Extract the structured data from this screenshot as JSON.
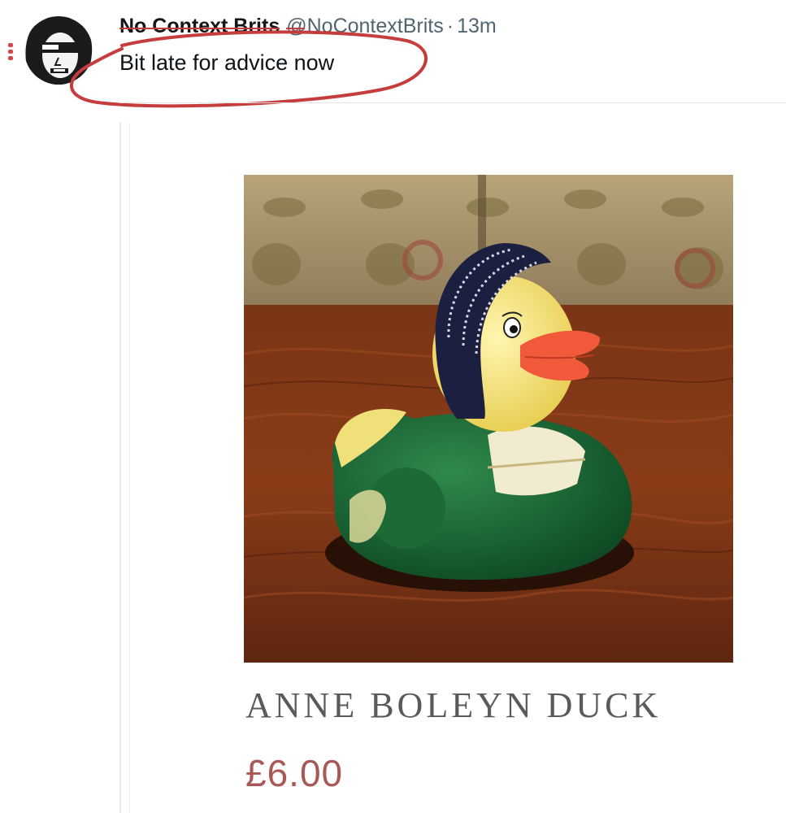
{
  "tweet": {
    "display_name": "No Context Brits",
    "handle": "@NoContextBrits",
    "separator": "·",
    "time": "13m",
    "text": "Bit late for advice now"
  },
  "product": {
    "title": "ANNE BOLEYN DUCK",
    "price": "£6.00",
    "image_icon": "rubber-duck-photo"
  },
  "colors": {
    "annotation_red": "#c63d3d",
    "price": "#a75a55",
    "title": "#5a5a5a"
  }
}
